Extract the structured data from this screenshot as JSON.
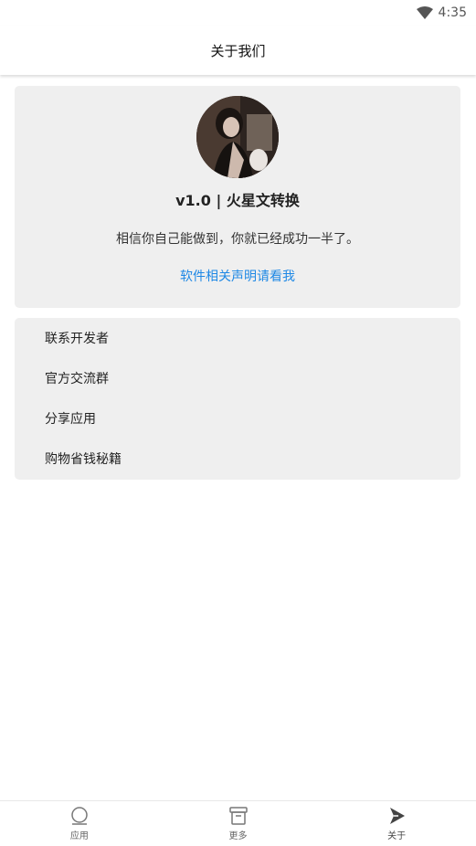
{
  "status_bar": {
    "time": "4:35",
    "wifi_icon": "wifi-icon"
  },
  "app_bar": {
    "title": "关于我们"
  },
  "profile": {
    "avatar_icon": "avatar-photo",
    "version_title": "v1.0 | 火星文转换",
    "motto": "相信你自己能做到，你就已经成功一半了。",
    "statement_link": "软件相关声明请看我",
    "link_color": "#1e88e5"
  },
  "menu": {
    "items": [
      {
        "label": "联系开发者"
      },
      {
        "label": "官方交流群"
      },
      {
        "label": "分享应用"
      },
      {
        "label": "购物省钱秘籍"
      }
    ]
  },
  "bottom_nav": {
    "items": [
      {
        "label": "应用",
        "icon": "app-circle-icon"
      },
      {
        "label": "更多",
        "icon": "box-icon"
      },
      {
        "label": "关于",
        "icon": "play-arrow-icon",
        "active": true
      }
    ]
  }
}
